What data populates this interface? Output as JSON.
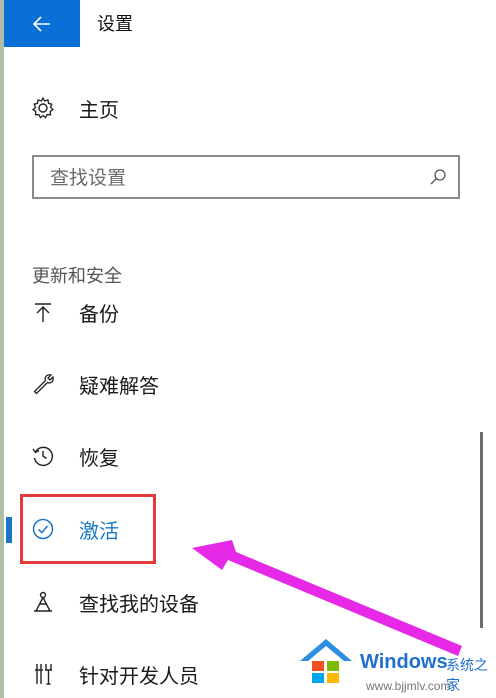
{
  "header": {
    "back_icon": "arrow-left-icon",
    "title": "设置"
  },
  "home": {
    "icon": "gear-icon",
    "label": "主页"
  },
  "search": {
    "placeholder": "查找设置",
    "value": "",
    "icon": "search-icon"
  },
  "section": {
    "title": "更新和安全"
  },
  "nav_items": [
    {
      "icon": "backup-arrow-icon",
      "label": "备份",
      "selected": false
    },
    {
      "icon": "wrench-icon",
      "label": "疑难解答",
      "selected": false
    },
    {
      "icon": "history-icon",
      "label": "恢复",
      "selected": false
    },
    {
      "icon": "check-circle-icon",
      "label": "激活",
      "selected": true
    },
    {
      "icon": "find-device-icon",
      "label": "查找我的设备",
      "selected": false
    },
    {
      "icon": "developer-tools-icon",
      "label": "针对开发人员",
      "selected": false
    }
  ],
  "annotation": {
    "highlight_color": "#e33b3b",
    "arrow_color": "#e629e6"
  },
  "colors": {
    "accent": "#1976c9",
    "back_button": "#0a6fd6"
  },
  "watermark": {
    "brand": "Windows",
    "site_name": "系统之家",
    "url": "www.bjjmlv.com"
  }
}
